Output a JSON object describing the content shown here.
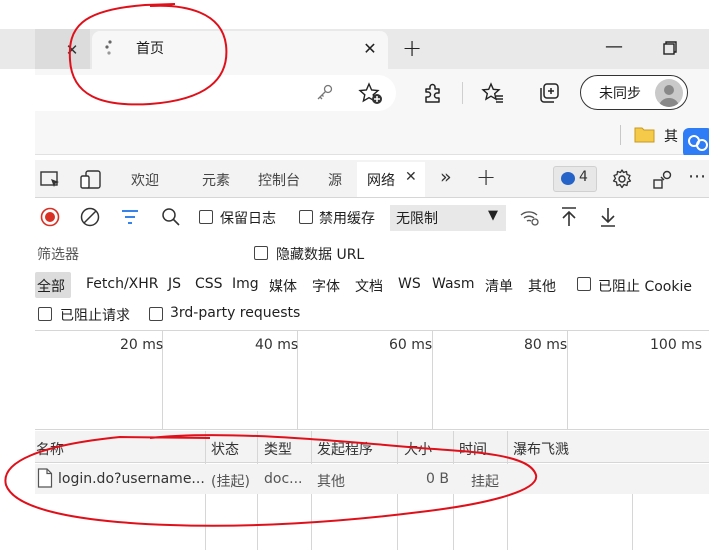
{
  "browser": {
    "tab_title": "首页",
    "new_tab_glyph": "+",
    "close_glyph": "✕",
    "minimize_glyph": "—",
    "sync_label": "未同步",
    "other_favorites": "其"
  },
  "devtools": {
    "tabs": [
      "欢迎",
      "元素",
      "控制台",
      "源",
      "网络"
    ],
    "active_tab": "网络",
    "issues_count": "4",
    "toolbar": {
      "preserve_log": "保留日志",
      "disable_cache": "禁用缓存",
      "throttling": "无限制"
    },
    "filter": {
      "placeholder": "筛选器",
      "hide_data_urls": "隐藏数据 URL"
    },
    "type_filters": [
      "全部",
      "Fetch/XHR",
      "JS",
      "CSS",
      "Img",
      "媒体",
      "字体",
      "文档",
      "WS",
      "Wasm",
      "清单",
      "其他"
    ],
    "blocked_cookies": "已阻止 Cookie",
    "blocked_requests": "已阻止请求",
    "third_party": "3rd-party requests",
    "timeline_ticks": [
      "20 ms",
      "40 ms",
      "60 ms",
      "80 ms",
      "100 ms"
    ],
    "columns": [
      "名称",
      "状态",
      "类型",
      "发起程序",
      "大小",
      "时间",
      "瀑布飞溅"
    ],
    "rows": [
      {
        "name": "login.do?username...",
        "status": "(挂起)",
        "type": "doc...",
        "initiator": "其他",
        "size": "0 B",
        "time": "挂起"
      }
    ]
  },
  "colors": {
    "annotation": "#e0101a",
    "record_stop": "#d93025",
    "filter_active": "#1a73e8"
  }
}
